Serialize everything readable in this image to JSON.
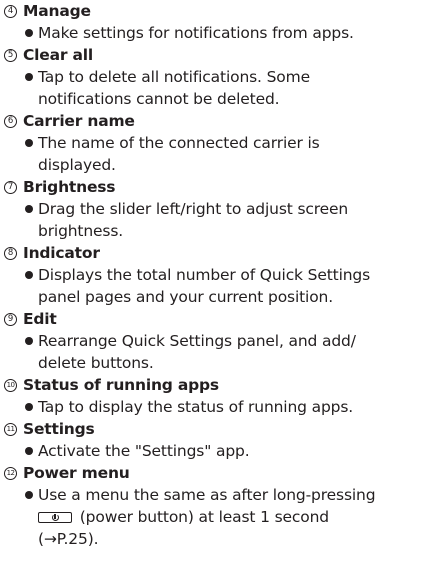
{
  "entries": [
    {
      "number": "4",
      "title": "Manage",
      "lines": [
        "Make settings for notifications from apps."
      ]
    },
    {
      "number": "5",
      "title": "Clear all",
      "lines": [
        "Tap to delete all notifications. Some",
        "notifications cannot be deleted."
      ]
    },
    {
      "number": "6",
      "title": "Carrier name",
      "lines": [
        "The name of the connected carrier is",
        "displayed."
      ]
    },
    {
      "number": "7",
      "title": "Brightness",
      "lines": [
        "Drag the slider left/right to adjust screen",
        "brightness."
      ]
    },
    {
      "number": "8",
      "title": "Indicator",
      "lines": [
        "Displays the total number of Quick Settings",
        "panel pages and your current position."
      ]
    },
    {
      "number": "9",
      "title": "Edit",
      "lines": [
        "Rearrange Quick Settings panel, and add/",
        "delete buttons."
      ]
    },
    {
      "number": "10",
      "title": "Status of running apps",
      "lines": [
        "Tap to display the status of running apps."
      ]
    },
    {
      "number": "11",
      "title": "Settings",
      "lines": [
        "Activate the \"Settings\" app."
      ]
    },
    {
      "number": "12",
      "title": "Power menu",
      "lines": [
        "Use a menu the same as after long-pressing"
      ],
      "line2_after_icon": "(power button) at least 1 second",
      "line3": "(→P.25)."
    }
  ],
  "icons": {
    "bullet": "filled-circle-bullet",
    "power_button": "power-button-icon"
  }
}
